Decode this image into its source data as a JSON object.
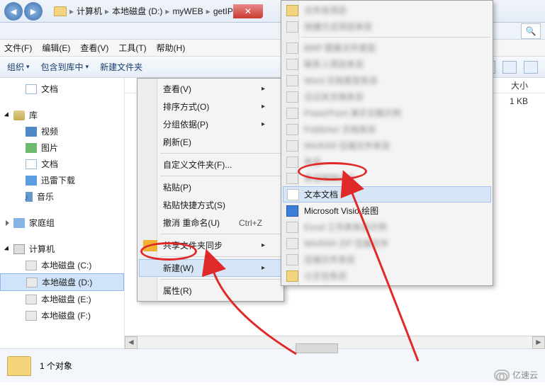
{
  "titlebar": {
    "crumbs": [
      "计算机",
      "本地磁盘 (D:)",
      "myWEB",
      "getIP"
    ]
  },
  "menubar": [
    "文件(F)",
    "编辑(E)",
    "查看(V)",
    "工具(T)",
    "帮助(H)"
  ],
  "toolbar": {
    "organize": "组织",
    "include": "包含到库中",
    "newfolder": "新建文件夹"
  },
  "columns": {
    "size": "大小"
  },
  "rows": {
    "r0": "1 KB"
  },
  "sidebar": {
    "doc": "文档",
    "lib": "库",
    "video": "视频",
    "pic": "图片",
    "docs": "文档",
    "thunder": "迅雷下载",
    "music": "音乐",
    "homegroup": "家庭组",
    "computer": "计算机",
    "diskC": "本地磁盘 (C:)",
    "diskD": "本地磁盘 (D:)",
    "diskE": "本地磁盘 (E:)",
    "diskF": "本地磁盘 (F:)"
  },
  "ctx1": {
    "view": "查看(V)",
    "sort": "排序方式(O)",
    "group": "分组依据(P)",
    "refresh": "刷新(E)",
    "customize": "自定义文件夹(F)...",
    "paste": "粘贴(P)",
    "pasteShortcut": "粘贴快捷方式(S)",
    "undo": "撤消 重命名(U)",
    "undoKey": "Ctrl+Z",
    "sync": "共享文件夹同步",
    "new": "新建(W)",
    "props": "属性(R)"
  },
  "ctx2": {
    "textdoc": "文本文档",
    "visio": "Microsoft Visio 绘图"
  },
  "status": {
    "count": "1 个对象"
  },
  "watermark": "亿速云"
}
